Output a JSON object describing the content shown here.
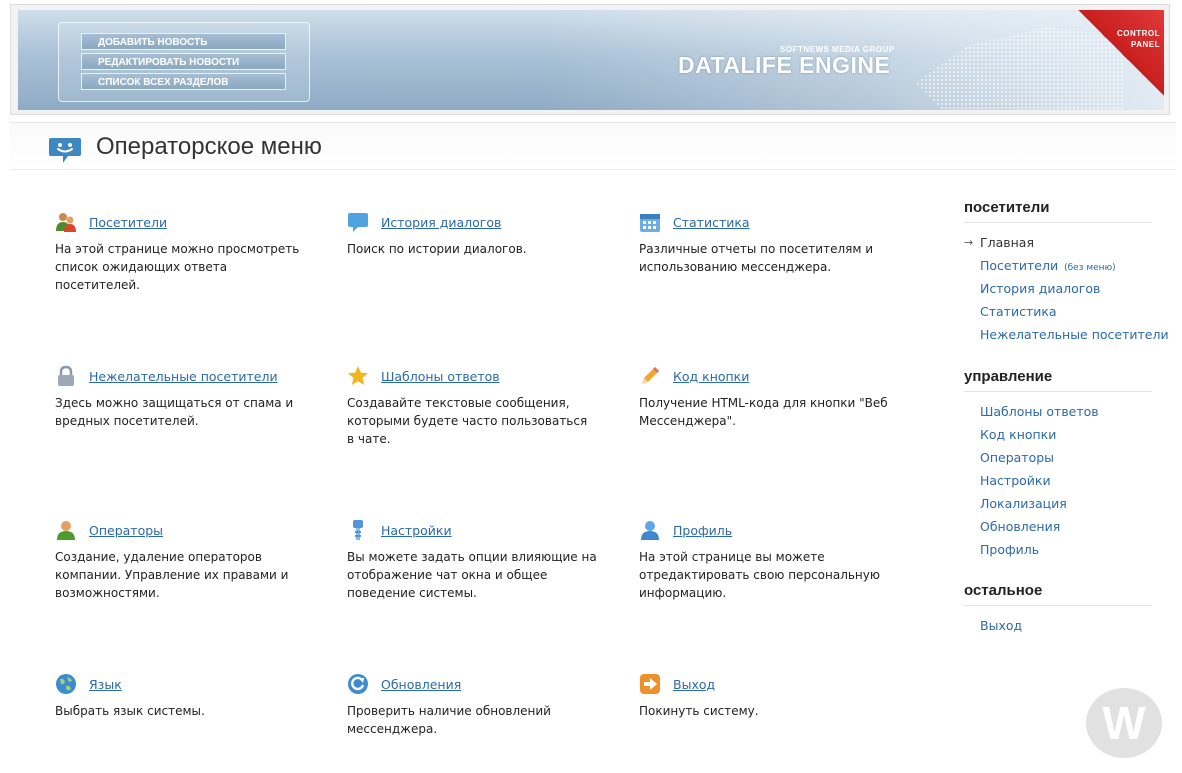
{
  "banner": {
    "menu": [
      "ДОБАВИТЬ НОВОСТЬ",
      "РЕДАКТИРОВАТЬ НОВОСТИ",
      "СПИСОК ВСЕХ РАЗДЕЛОВ"
    ],
    "brand_small": "SOFTNEWS MEDIA GROUP",
    "brand": "DATALIFE ENGINE",
    "corner_line1": "CONTROL",
    "corner_line2": "PANEL"
  },
  "page": {
    "title": "Операторское меню"
  },
  "items": [
    {
      "icon": "visitors-icon",
      "label": "Посетители",
      "desc": "На этой странице можно просмотреть список ожидающих ответа посетителей."
    },
    {
      "icon": "chat-bubble-icon",
      "label": "История диалогов",
      "desc": "Поиск по истории диалогов."
    },
    {
      "icon": "calendar-icon",
      "label": "Статистика",
      "desc": "Различные отчеты по посетителям и использованию мессенджера."
    },
    {
      "icon": "lock-icon",
      "label": "Нежелательные посетители",
      "desc": "Здесь можно защищаться от спама и вредных посетителей."
    },
    {
      "icon": "star-icon",
      "label": "Шаблоны ответов",
      "desc": "Создавайте текстовые сообщения, которыми будете часто пользоваться в чате."
    },
    {
      "icon": "pencil-icon",
      "label": "Код кнопки",
      "desc": "Получение HTML-кода для кнопки \"Веб Мессенджера\"."
    },
    {
      "icon": "operator-icon",
      "label": "Операторы",
      "desc": "Создание, удаление операторов компании. Управление их правами и возможностями."
    },
    {
      "icon": "settings-icon",
      "label": "Настройки",
      "desc": "Вы можете задать опции влияющие на отображение чат окна и общее поведение системы."
    },
    {
      "icon": "profile-icon",
      "label": "Профиль",
      "desc": "На этой странице вы можете отредактировать свою персональную информацию."
    },
    {
      "icon": "globe-icon",
      "label": "Язык",
      "desc": "Выбрать язык системы."
    },
    {
      "icon": "refresh-icon",
      "label": "Обновления",
      "desc": "Проверить наличие обновлений мессенджера."
    },
    {
      "icon": "exit-icon",
      "label": "Выход",
      "desc": "Покинуть систему."
    }
  ],
  "sidebar": {
    "visitors": {
      "heading": "посетители",
      "items": [
        "Главная",
        "Посетители",
        "История диалогов",
        "Статистика",
        "Нежелательные посетители"
      ],
      "note": "(без меню)"
    },
    "management": {
      "heading": "управление",
      "items": [
        "Шаблоны ответов",
        "Код кнопки",
        "Операторы",
        "Настройки",
        "Локализация",
        "Обновления",
        "Профиль"
      ]
    },
    "other": {
      "heading": "остальное",
      "items": [
        "Выход"
      ]
    }
  },
  "watermark": "W",
  "colors": {
    "link": "#2b6aa8",
    "banner": "#a9c1d6",
    "corner": "#c81e1e"
  }
}
